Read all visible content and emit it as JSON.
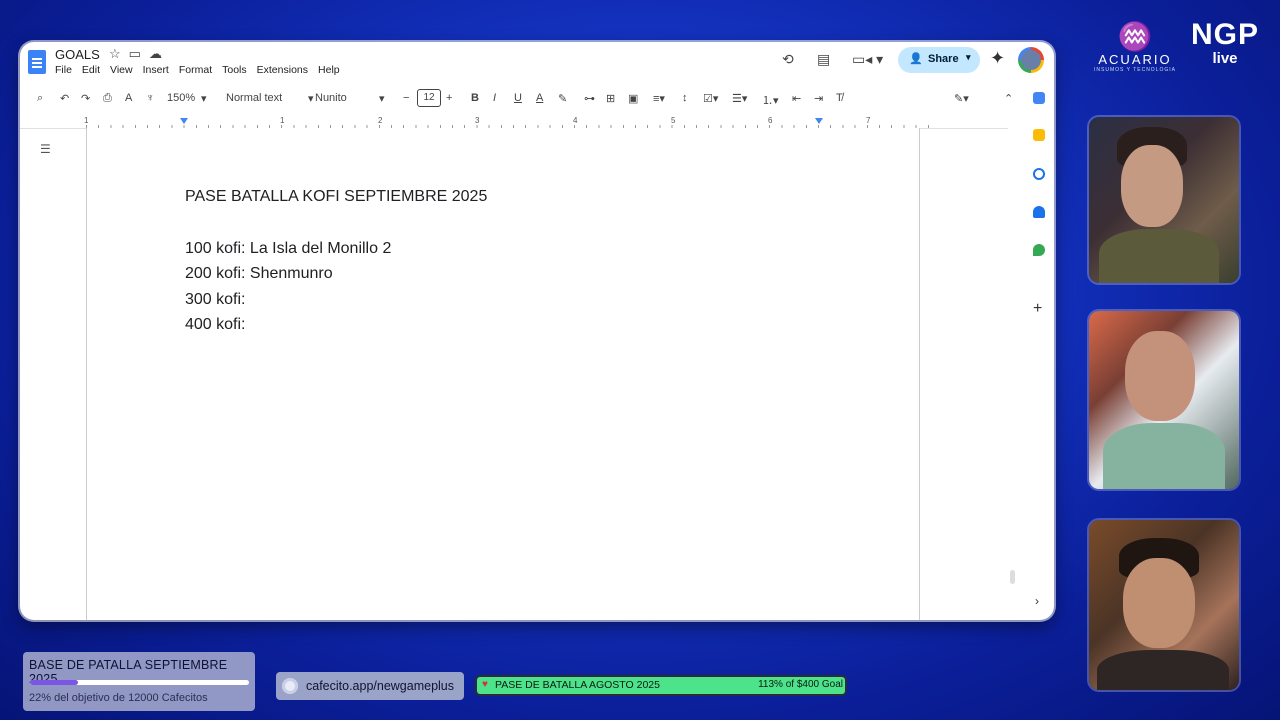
{
  "doc": {
    "title": "GOALS",
    "menu": [
      "File",
      "Edit",
      "View",
      "Insert",
      "Format",
      "Tools",
      "Extensions",
      "Help"
    ],
    "share_label": "Share",
    "toolbar": {
      "zoom": "150%",
      "style": "Normal text",
      "font": "Nunito",
      "font_size": "12"
    },
    "ruler_ticks": [
      "1",
      "1",
      "2",
      "3",
      "4",
      "5",
      "6",
      "7"
    ],
    "content": {
      "heading": "PASE BATALLA KOFI SEPTIEMBRE 2025",
      "lines": [
        "100 kofi: La Isla del Monillo 2",
        "200 kofi: Shenmunro",
        "300 kofi:",
        "400 kofi:"
      ]
    }
  },
  "branding": {
    "logo_left_name": "ACUARIO",
    "logo_left_sub": "INSUMOS Y TECNOLOGIA",
    "logo_right_top": "NGP",
    "logo_right_bottom": "live"
  },
  "widgets": {
    "goal": {
      "title": "BASE DE PATALLA SEPTIEMBRE 2025",
      "subtitle": "22% del objetivo de 12000 Cafecitos",
      "progress": 0.22
    },
    "cafecito": {
      "url": "cafecito.app/newgameplus"
    },
    "kofi_goal": {
      "title": "PASE DE BATALLA AGOSTO 2025",
      "progress_text": "113% of $400 Goal",
      "progress": 1.13
    }
  },
  "colors": {
    "share_bg": "#c2e7ff",
    "goal_fill": "#7b55e6",
    "kofi_bar": "#4ce38a"
  }
}
